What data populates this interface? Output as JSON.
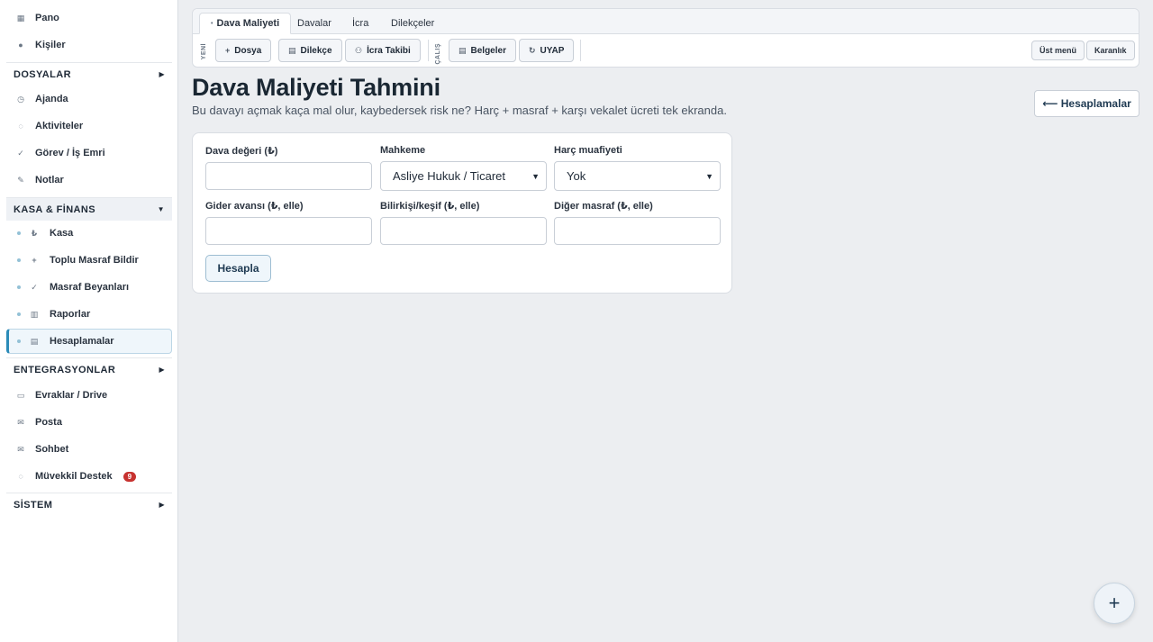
{
  "sidebar": {
    "items_top": [
      {
        "label": "Pano",
        "icon": "dashboard-icon"
      },
      {
        "label": "Kişiler",
        "icon": "people-icon"
      }
    ],
    "section_dosyalar": "DOSYALAR",
    "items_dosyalar": [
      {
        "label": "Ajanda",
        "icon": "clock-icon"
      },
      {
        "label": "Aktiviteler",
        "icon": "activity-icon"
      },
      {
        "label": "Görev / İş Emri",
        "icon": "check-icon"
      },
      {
        "label": "Notlar",
        "icon": "pencil-icon"
      }
    ],
    "section_kasa": "KASA & FİNANS",
    "items_kasa": [
      {
        "label": "Kasa",
        "icon": "lira-icon"
      },
      {
        "label": "Toplu Masraf Bildir",
        "icon": "plus-icon"
      },
      {
        "label": "Masraf Beyanları",
        "icon": "check-icon"
      },
      {
        "label": "Raporlar",
        "icon": "chart-icon"
      },
      {
        "label": "Hesaplamalar",
        "icon": "calculator-icon"
      }
    ],
    "section_entegrasyonlar": "ENTEGRASYONLAR",
    "items_entegrasyonlar": [
      {
        "label": "Evraklar / Drive",
        "icon": "folder-icon"
      },
      {
        "label": "Posta",
        "icon": "mail-icon"
      },
      {
        "label": "Sohbet",
        "icon": "chat-icon"
      },
      {
        "label": "Müvekkil Destek",
        "icon": "support-icon",
        "badge": "9"
      }
    ],
    "section_sistem": "SİSTEM"
  },
  "toolbar": {
    "tabs": [
      "Dava Maliyeti",
      "Davalar",
      "İcra",
      "Dilekçeler"
    ],
    "group_new_label": "YENİ",
    "group_work_label": "ÇALIŞ",
    "btn_dosya": "Dosya",
    "btn_dilekce": "Dilekçe",
    "btn_icra": "İcra Takibi",
    "btn_belgeler": "Belgeler",
    "btn_uyap": "UYAP",
    "btn_ust_menu": "Üst menü",
    "btn_karanlik": "Karanlık"
  },
  "header": {
    "title": "Dava Maliyeti Tahmini",
    "subtitle": "Bu davayı açmak kaça mal olur, kaybedersek risk ne? Harç + masraf + karşı vekalet ücreti tek ekranda.",
    "back_button": "⟵ Hesaplamalar"
  },
  "form": {
    "dava_degeri_label": "Dava değeri (₺)",
    "dava_degeri_value": "",
    "mahkeme_label": "Mahkeme",
    "mahkeme_value": "Asliye Hukuk / Ticaret",
    "harc_label": "Harç muafiyeti",
    "harc_value": "Yok",
    "gider_label": "Gider avansı (₺, elle)",
    "gider_value": "",
    "bilirkisi_label": "Bilirkişi/keşif (₺, elle)",
    "bilirkisi_value": "",
    "diger_label": "Diğer masraf (₺, elle)",
    "diger_value": "",
    "calc_button": "Hesapla"
  },
  "fab": "+"
}
